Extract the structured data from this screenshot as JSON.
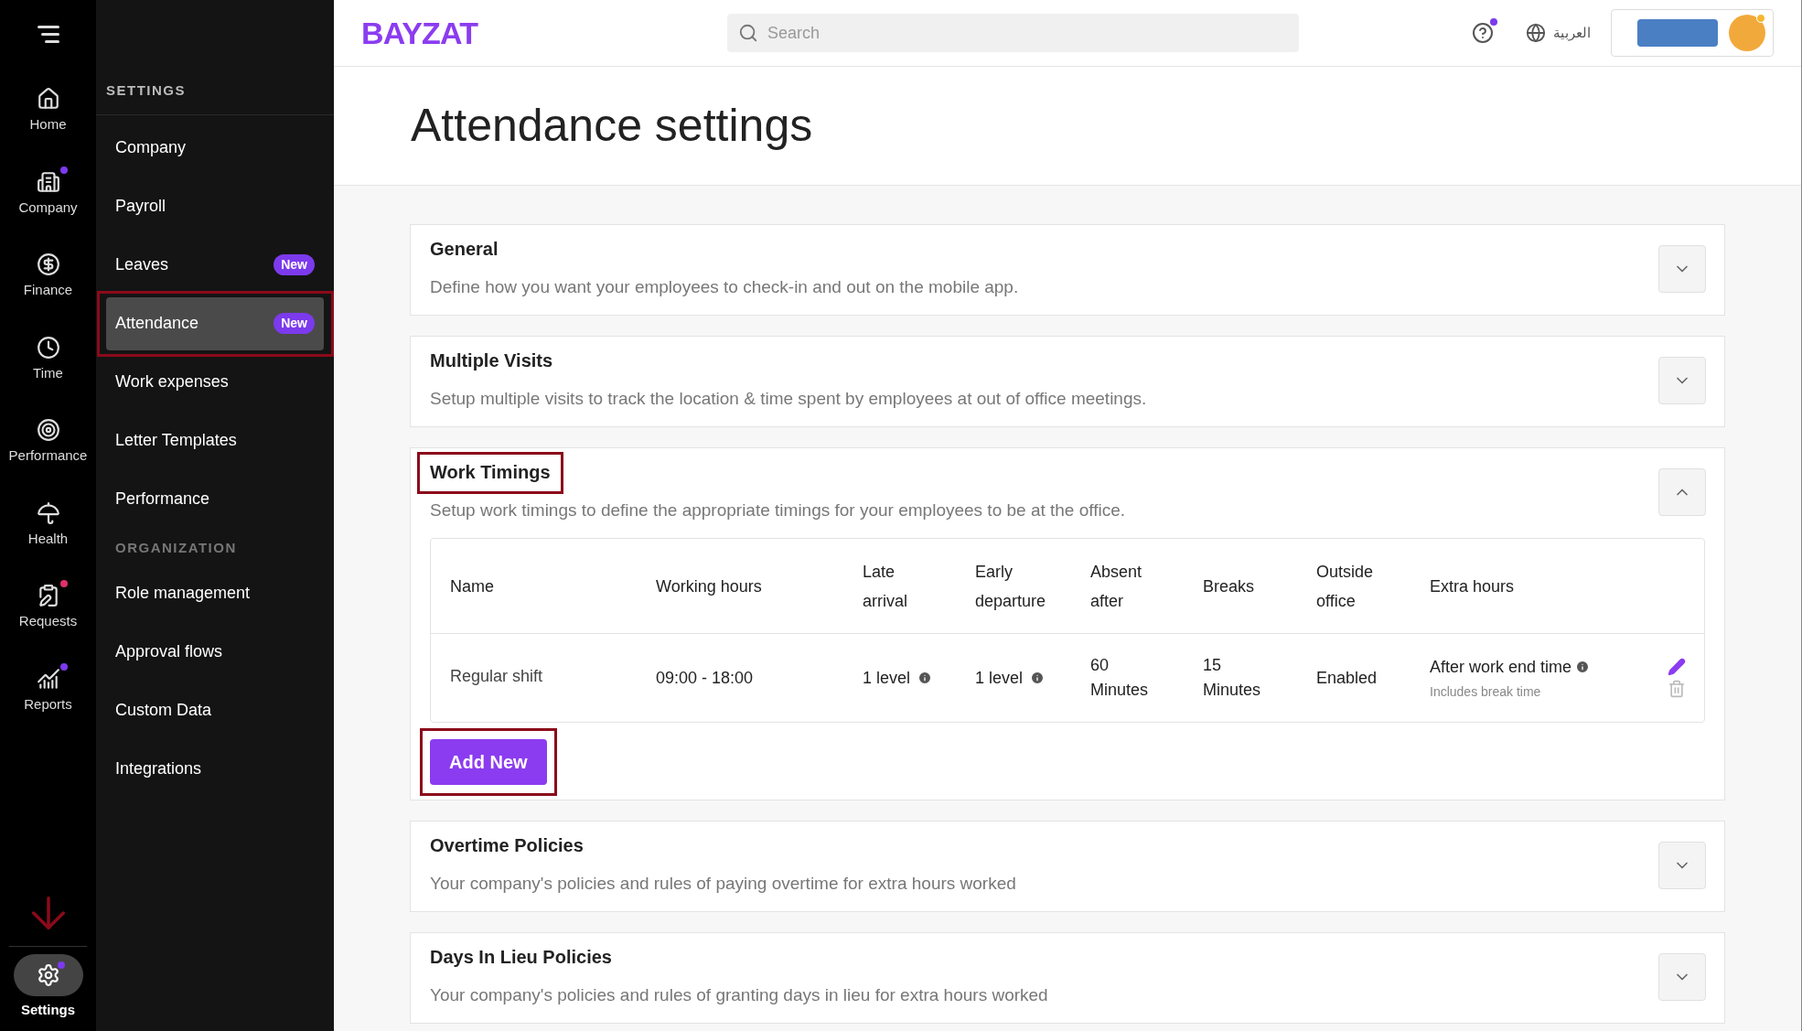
{
  "rail": {
    "items": [
      {
        "label": "Home",
        "selected": false,
        "notification": false
      },
      {
        "label": "Company",
        "selected": false,
        "notification": true,
        "color": "#7c3aed"
      },
      {
        "label": "Finance",
        "selected": false,
        "notification": false
      },
      {
        "label": "Time",
        "selected": false,
        "notification": false
      },
      {
        "label": "Performance",
        "selected": false,
        "notification": false
      },
      {
        "label": "Health",
        "selected": false,
        "notification": false
      },
      {
        "label": "Requests",
        "selected": false,
        "notification": true,
        "color": "#e0306f"
      },
      {
        "label": "Reports",
        "selected": false,
        "notification": true,
        "color": "#7c3aed"
      }
    ],
    "settings": {
      "label": "Settings",
      "selected": true,
      "notification": true
    }
  },
  "sidebar": {
    "groups": [
      {
        "heading": "SETTINGS",
        "items": [
          {
            "label": "Company",
            "selected": false,
            "highlighted": false
          },
          {
            "label": "Payroll",
            "selected": false,
            "highlighted": false
          },
          {
            "label": "Leaves",
            "badge": "New",
            "selected": false,
            "highlighted": false
          },
          {
            "label": "Attendance",
            "badge": "New",
            "selected": true,
            "highlighted": true
          },
          {
            "label": "Work expenses",
            "selected": false,
            "highlighted": false
          },
          {
            "label": "Letter Templates",
            "selected": false,
            "highlighted": false
          },
          {
            "label": "Performance",
            "selected": false,
            "highlighted": false
          }
        ]
      },
      {
        "heading": "ORGANIZATION",
        "items": [
          {
            "label": "Role management",
            "selected": false,
            "highlighted": false
          },
          {
            "label": "Approval flows",
            "selected": false,
            "highlighted": false
          },
          {
            "label": "Custom Data",
            "selected": false,
            "highlighted": false
          },
          {
            "label": "Integrations",
            "selected": false,
            "highlighted": false
          }
        ]
      }
    ]
  },
  "topbar": {
    "logo": "BAYZAT",
    "search": {
      "placeholder": "Search"
    },
    "help_notification": true,
    "language": "العربية"
  },
  "page": {
    "title": "Attendance settings"
  },
  "sections": [
    {
      "title": "General",
      "description": "Define how you want your employees to check-in and out on the mobile app.",
      "expanded": false,
      "highlighted": false
    },
    {
      "title": "Multiple Visits",
      "description": "Setup multiple visits to track the location & time spent by employees at out of office meetings.",
      "expanded": false,
      "highlighted": false
    },
    {
      "title": "Work Timings",
      "description": "Setup work timings to define the appropriate timings for your employees to be at the office.",
      "expanded": true,
      "highlighted": true,
      "table": {
        "columns": [
          "Name",
          "Working hours",
          "Late arrival",
          "Early departure",
          "Absent after",
          "Breaks",
          "Outside office",
          "Extra hours"
        ],
        "rows": [
          {
            "name": "Regular shift",
            "working_hours": "09:00 - 18:00",
            "late_arrival": "1 level",
            "early_departure": "1 level",
            "absent_after": "60 Minutes",
            "breaks": "15 Minutes",
            "outside_office": "Enabled",
            "extra_hours": "After work end time",
            "extra_hours_note": "Includes break time"
          }
        ]
      },
      "add_button": {
        "label": "Add New",
        "highlighted": true
      }
    },
    {
      "title": "Overtime Policies",
      "description": "Your company's policies and rules of paying overtime for extra hours worked",
      "expanded": false,
      "highlighted": false
    },
    {
      "title": "Days In Lieu Policies",
      "description": "Your company's policies and rules of granting days in lieu for extra hours worked",
      "expanded": false,
      "highlighted": false
    }
  ]
}
